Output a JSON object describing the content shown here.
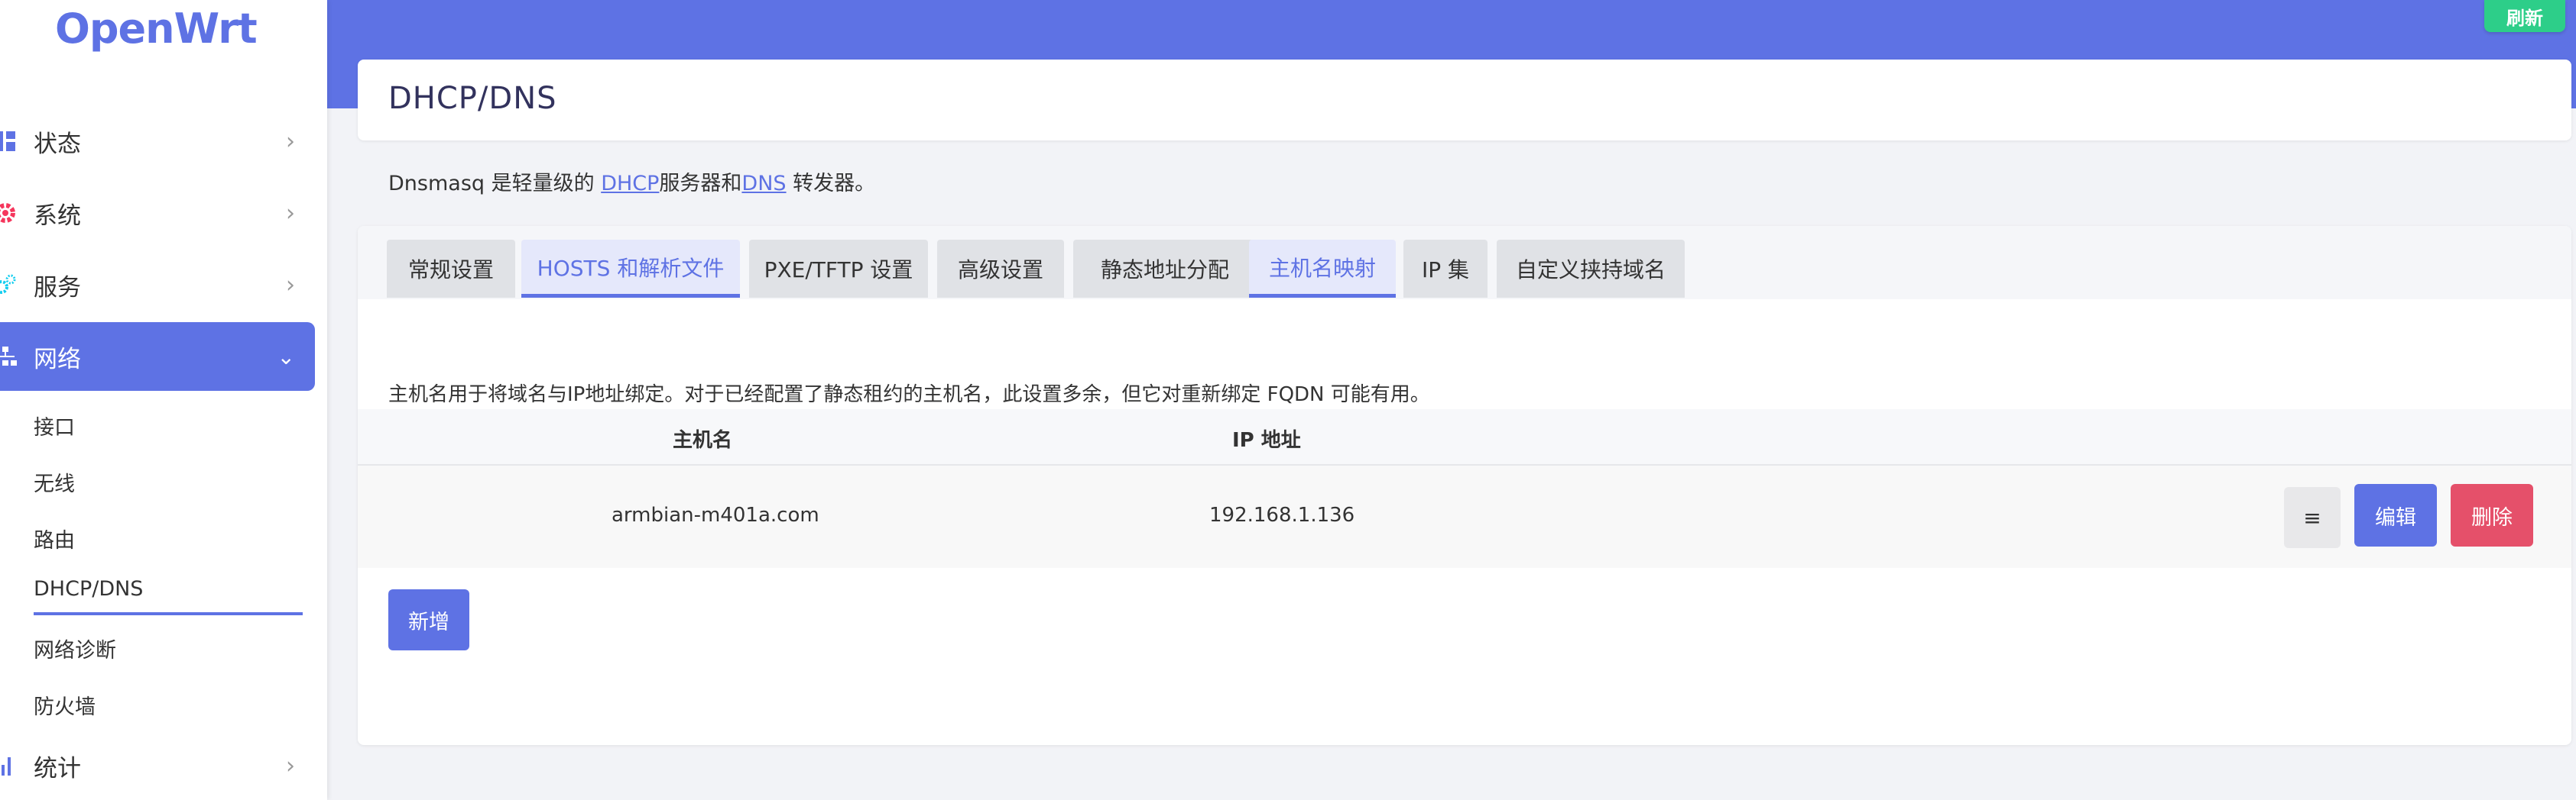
{
  "app": {
    "logo": "OpenWrt",
    "refresh_label": "刷新"
  },
  "sidebar": {
    "items": [
      {
        "label": "状态",
        "icon": "dashboard-icon",
        "color": "#5e72e4"
      },
      {
        "label": "系统",
        "icon": "gear-icon",
        "color": "#f5365c"
      },
      {
        "label": "服务",
        "icon": "gears-icon",
        "color": "#11cdef"
      },
      {
        "label": "网络",
        "icon": "sitemap-icon",
        "color": "#ffffff",
        "active": true
      },
      {
        "label": "统计",
        "icon": "bar-chart-icon",
        "color": "#5e72e4"
      }
    ],
    "sub_items": [
      {
        "label": "接口"
      },
      {
        "label": "无线"
      },
      {
        "label": "路由"
      },
      {
        "label": "DHCP/DNS",
        "active": true
      },
      {
        "label": "网络诊断"
      },
      {
        "label": "防火墙"
      }
    ]
  },
  "page": {
    "title": "DHCP/DNS",
    "desc_prefix": "Dnsmasq 是轻量级的 ",
    "desc_link1": "DHCP",
    "desc_mid": "服务器和",
    "desc_link2": "DNS",
    "desc_suffix": " 转发器。"
  },
  "tabs": [
    {
      "label": "常规设置"
    },
    {
      "label": "HOSTS 和解析文件",
      "selected": true
    },
    {
      "label": "PXE/TFTP 设置"
    },
    {
      "label": "高级设置"
    },
    {
      "label": "静态地址分配"
    },
    {
      "label": "主机名映射",
      "selected": true
    },
    {
      "label": "IP 集"
    },
    {
      "label": "自定义挟持域名"
    }
  ],
  "hostnames": {
    "description": "主机名用于将域名与IP地址绑定。对于已经配置了静态租约的主机名，此设置多余，但它对重新绑定 FQDN 可能有用。",
    "columns": [
      "主机名",
      "IP 地址"
    ],
    "rows": [
      {
        "hostname": "armbian-m401a.com",
        "ip": "192.168.1.136"
      }
    ],
    "sort_label": "≡",
    "edit_label": "编辑",
    "delete_label": "删除",
    "add_label": "新增"
  }
}
